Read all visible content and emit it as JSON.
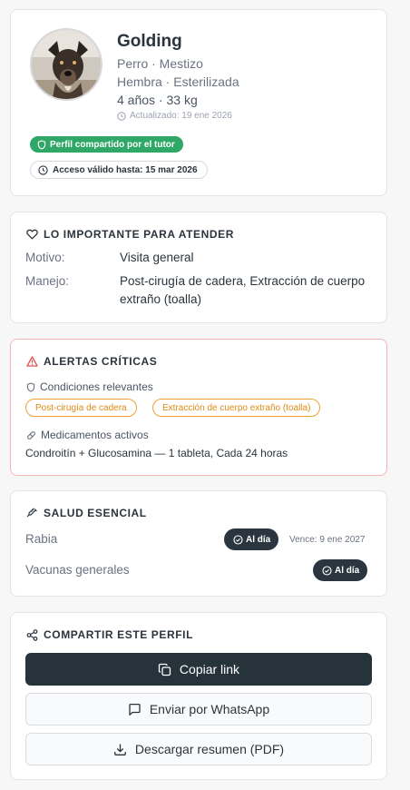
{
  "profile": {
    "name": "Golding",
    "species_breed": "Perro · Mestizo",
    "sex_status": "Hembra · Esterilizada",
    "age_weight": "4 años · 33 kg",
    "updated": "Actualizado: 19 ene 2026",
    "shared_badge": "Perfil compartido por el tutor",
    "access_badge": "Acceso válido hasta: 15 mar 2026"
  },
  "important": {
    "title": "LO IMPORTANTE PARA ATENDER",
    "reason_label": "Motivo:",
    "reason_value": "Visita general",
    "handling_label": "Manejo:",
    "handling_value": "Post-cirugía de cadera, Extracción de cuerpo extraño (toalla)"
  },
  "alerts": {
    "title": "ALERTAS CRÍTICAS",
    "conditions_title": "Condiciones relevantes",
    "conditions": [
      "Post-cirugía de cadera",
      "Extracción de cuerpo extraño (toalla)"
    ],
    "medications_title": "Medicamentos activos",
    "medication": "Condroitín + Glucosamina — 1 tableta, Cada 24 horas"
  },
  "health": {
    "title": "SALUD ESENCIAL",
    "rows": [
      {
        "name": "Rabia",
        "status": "Al día",
        "expiry": "Vence: 9 ene 2027"
      },
      {
        "name": "Vacunas generales",
        "status": "Al día"
      }
    ]
  },
  "share": {
    "title": "COMPARTIR ESTE PERFIL",
    "copy_label": "Copiar link",
    "whatsapp_label": "Enviar por WhatsApp",
    "pdf_label": "Descargar resumen (PDF)"
  },
  "colors": {
    "primary_dark": "#27333b",
    "success_green": "#2fa867",
    "alert_red": "#e05252",
    "chip_orange": "#e08a14"
  }
}
